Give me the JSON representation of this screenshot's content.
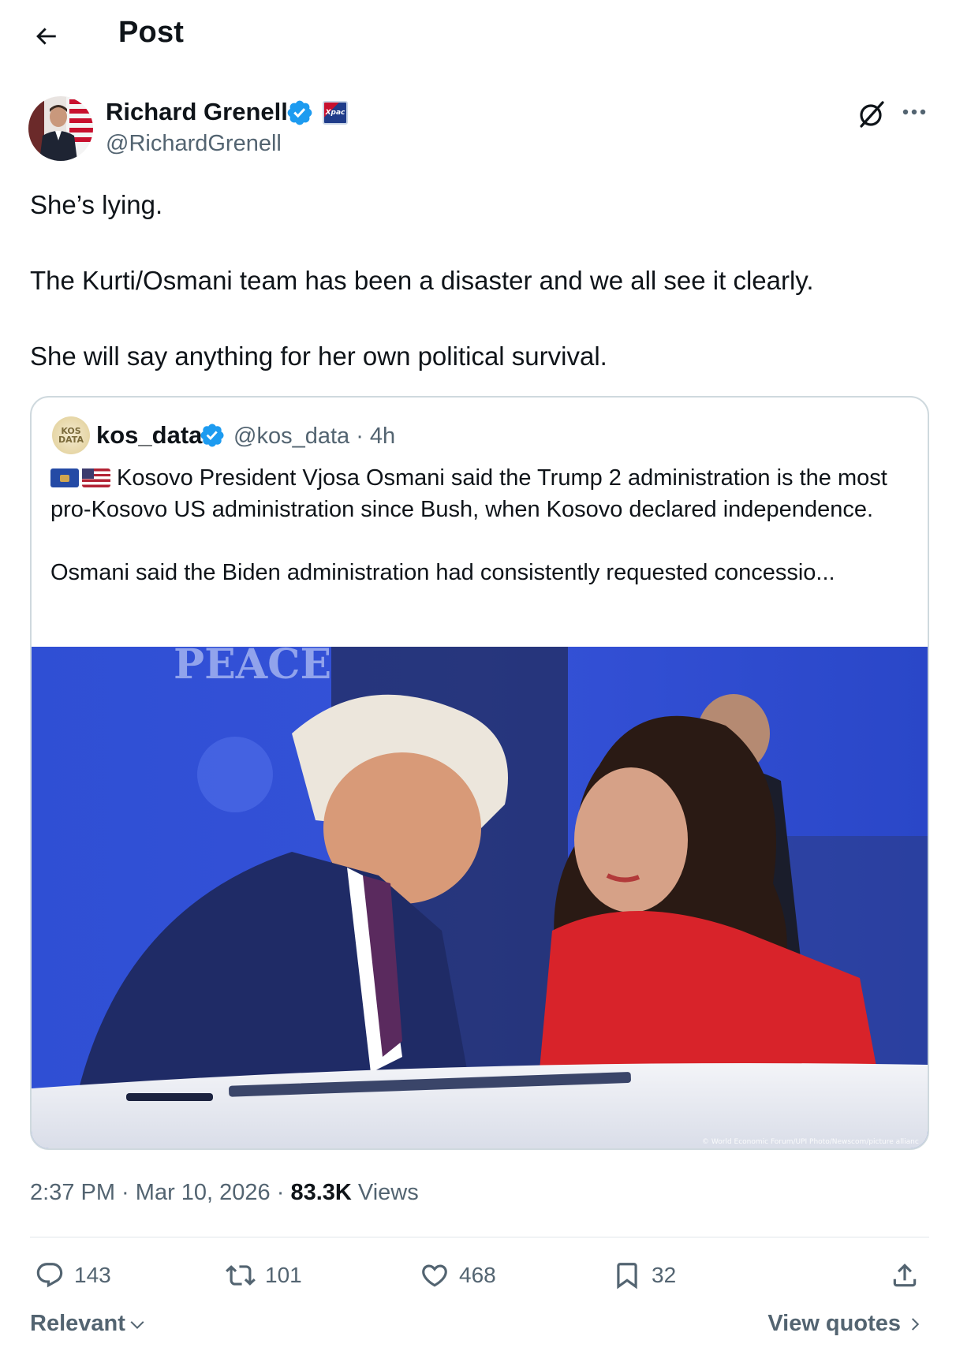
{
  "header": {
    "title": "Post",
    "back_icon": "arrow-left-icon"
  },
  "author": {
    "name": "Richard Grenell",
    "handle": "@RichardGrenell",
    "affiliate_badge_text": "Xpac"
  },
  "post": {
    "paragraphs": [
      "She’s lying.",
      "The Kurti/Osmani team has been a disaster and we all see it clearly.",
      "She will say anything for her own political survival."
    ]
  },
  "quote": {
    "name": "kos_data",
    "handle_time": "@kos_data · 4h",
    "avatar_text": "KOS DATA",
    "text_para1": "Kosovo President Vjosa Osmani said the Trump 2 administration is the most pro-Kosovo US administration since Bush, when Kosovo declared independence.",
    "text_para2": "Osmani said the Biden administration had consistently requested concessio...",
    "image_banner_text": "PEACE",
    "image_credit": "© World Economic Forum/UPI Photo/Newscom/picture allianc"
  },
  "meta": {
    "time": "2:37 PM",
    "sep1": " · ",
    "date": "Mar 10, 2026",
    "sep2": " · ",
    "views_count": "83.3K",
    "views_label": "Views"
  },
  "actions": {
    "replies": "143",
    "reposts": "101",
    "likes": "468",
    "bookmarks": "32"
  },
  "footer": {
    "sort_label": "Relevant",
    "view_quotes_label": "View quotes"
  },
  "colors": {
    "verified_blue": "#1d9bf0",
    "text_primary": "#0f1419",
    "text_secondary": "#536471",
    "border": "#cfd9de"
  }
}
